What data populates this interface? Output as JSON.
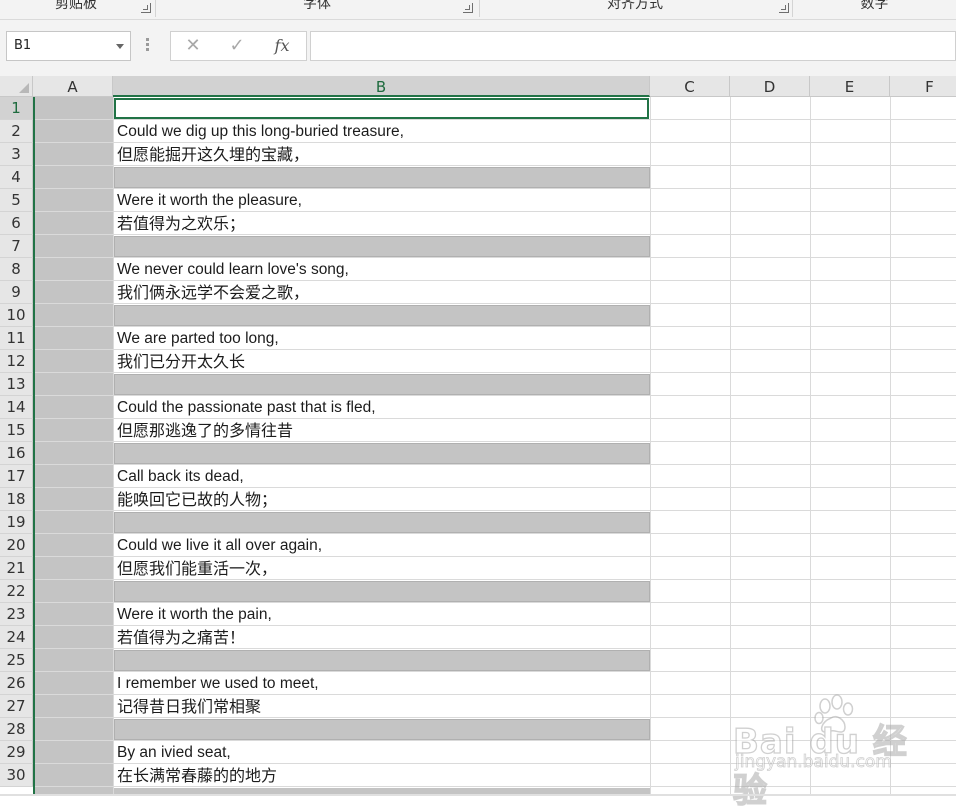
{
  "ribbon": {
    "groups": [
      {
        "label": "剪贴板"
      },
      {
        "label": "字体"
      },
      {
        "label": "对齐方式"
      },
      {
        "label": "数字"
      }
    ]
  },
  "formula_bar": {
    "name_box": "B1",
    "cancel_icon": "close-icon",
    "enter_icon": "check-icon",
    "fx_label": "fx",
    "formula_value": ""
  },
  "sheet": {
    "columns": [
      "A",
      "B",
      "C",
      "D",
      "E",
      "F"
    ],
    "selected_column": "B",
    "active_cell": "B1",
    "row_numbers": [
      "1",
      "2",
      "3",
      "4",
      "5",
      "6",
      "7",
      "8",
      "9",
      "10",
      "11",
      "12",
      "13",
      "14",
      "15",
      "16",
      "17",
      "18",
      "19",
      "20",
      "21",
      "22",
      "23",
      "24",
      "25",
      "26",
      "27",
      "28",
      "29",
      "30"
    ],
    "cells_b": [
      "",
      "Could we dig up this long-buried treasure,",
      "但愿能掘开这久埋的宝藏，",
      "",
      "Were it worth the pleasure,",
      "若值得为之欢乐；",
      "",
      "We never could learn love's song,",
      "我们俩永远学不会爱之歌，",
      "",
      "We are parted too long,",
      "我们已分开太久长",
      "",
      "Could the passionate past that is fled,",
      "但愿那逃逸了的多情往昔",
      "",
      "Call back its dead,",
      "能唤回它已故的人物；",
      "",
      "Could we live it all over again,",
      "但愿我们能重活一次，",
      "",
      "Were it worth the pain,",
      "若值得为之痛苦！",
      "",
      "I remember we used to meet,",
      "记得昔日我们常相聚",
      "",
      "By an ivied seat,",
      "在长满常春藤的的地方"
    ],
    "gray_rows": [
      4,
      7,
      10,
      13,
      16,
      19,
      22,
      25,
      28
    ],
    "fill_color": "#c4c4c4",
    "accent_color": "#217346"
  },
  "watermark": {
    "brand": "Bai du 经验",
    "url": "jingyan.baidu.com"
  }
}
